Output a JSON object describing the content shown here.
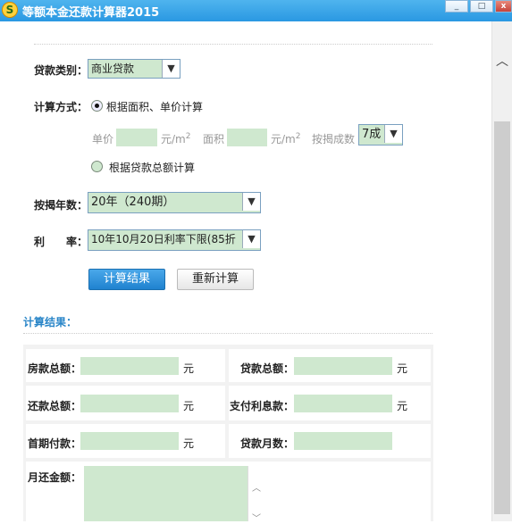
{
  "window": {
    "title": "等额本金还款计算器2015",
    "controls": [
      "_",
      "□",
      "x"
    ]
  },
  "form": {
    "loan_type": {
      "label": "贷款类别：",
      "value": "商业贷款"
    },
    "calc_method": {
      "label": "计算方式：",
      "option1": "根据面积、单价计算",
      "option2": "根据贷款总额计算",
      "selected": "option1"
    },
    "unit_price": {
      "label": "单价",
      "unit": "元/m",
      "sup": "2",
      "value": ""
    },
    "area": {
      "label": "面积",
      "unit": "元/m",
      "sup": "2",
      "value": ""
    },
    "mortgage_ratio": {
      "label": "按揭成数",
      "value": "7成"
    },
    "years": {
      "label": "按揭年数：",
      "value": "20年（240期）"
    },
    "rate": {
      "label_a": "利",
      "label_b": "率：",
      "value": "10年10月20日利率下限(85折"
    },
    "calc_button": "计算结果",
    "reset_button": "重新计算"
  },
  "results": {
    "title": "计算结果：",
    "house_total": {
      "label": "房款总额：",
      "unit": "元",
      "value": ""
    },
    "loan_total": {
      "label": "贷款总额：",
      "unit": "元",
      "value": ""
    },
    "repay_total": {
      "label": "还款总额：",
      "unit": "元",
      "value": ""
    },
    "interest": {
      "label": "支付利息款：",
      "unit": "元",
      "value": ""
    },
    "down_payment": {
      "label": "首期付款：",
      "unit": "元",
      "value": ""
    },
    "months": {
      "label": "贷款月数：",
      "value": ""
    },
    "monthly": {
      "label": "月还金额：",
      "value": ""
    }
  },
  "colors": {
    "title_bar": "#2a98e2",
    "field_fill": "#cfe8cf",
    "primary_button": "#1f82cf",
    "result_title": "#2a86c8"
  }
}
